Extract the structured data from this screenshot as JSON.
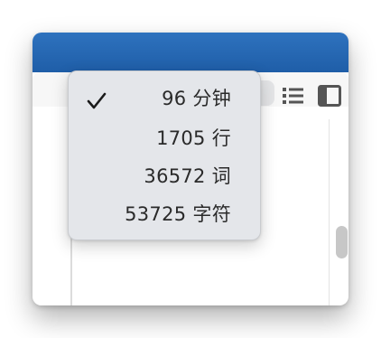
{
  "menu": {
    "items": [
      {
        "label": "96 分钟",
        "checked": true
      },
      {
        "label": "1705 行",
        "checked": false
      },
      {
        "label": "36572 词",
        "checked": false
      },
      {
        "label": "53725 字符",
        "checked": false
      }
    ]
  },
  "colors": {
    "titlebar": "#2566b2",
    "menu_bg": "#e4e6ea",
    "toolbar_bg": "#f7f7f7",
    "icon": "#555555"
  },
  "icons": {
    "check": "checkmark-icon",
    "list": "list-icon",
    "panel": "sidebar-panel-icon"
  }
}
